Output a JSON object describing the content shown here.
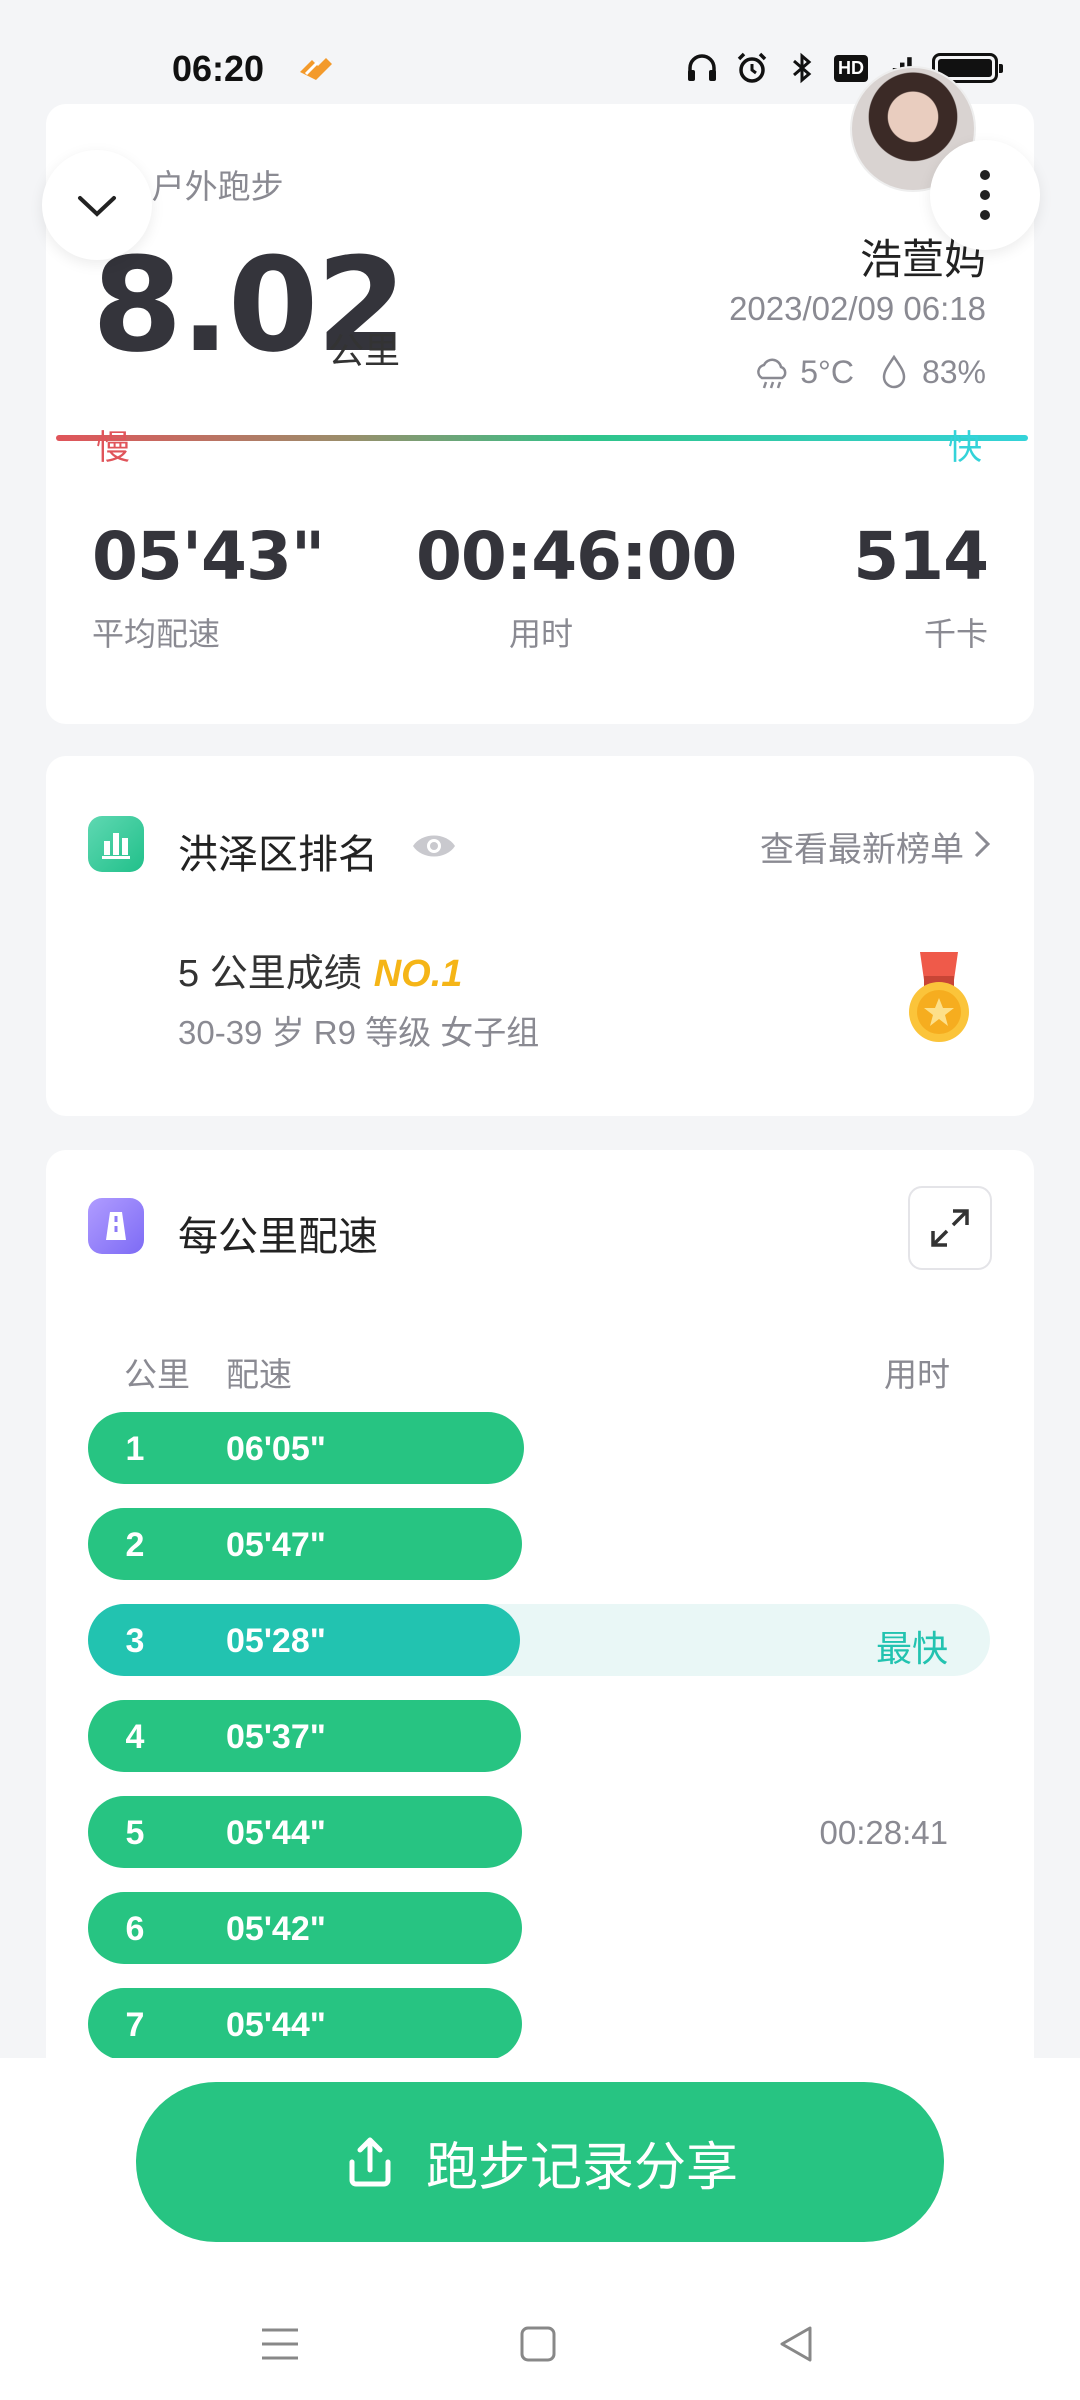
{
  "status_bar": {
    "time": "06:20",
    "hd": "HD",
    "network": "4G"
  },
  "summary": {
    "activity_type": "p · 户外跑步",
    "distance": "8.02",
    "distance_unit": "公里",
    "user_name": "浩萱妈",
    "datetime": "2023/02/09 06:18",
    "temperature": "5°C",
    "humidity": "83%",
    "pace_slow_label": "慢",
    "pace_fast_label": "快",
    "stats": [
      {
        "value": "05'43\"",
        "label": "平均配速"
      },
      {
        "value": "00:46:00",
        "label": "用时"
      },
      {
        "value": "514",
        "label": "千卡"
      }
    ]
  },
  "ranking": {
    "title": "洪泽区排名",
    "link_label": "查看最新榜单",
    "result_label": "5 公里成绩",
    "result_rank": "NO.1",
    "group_label": "30-39 岁 R9 等级 女子组"
  },
  "splits": {
    "title": "每公里配速",
    "col_km": "公里",
    "col_pace": "配速",
    "col_time": "用时",
    "fastest_label": "最快",
    "rows": [
      {
        "km": "1",
        "pace": "06'05\"",
        "elapsed": ""
      },
      {
        "km": "2",
        "pace": "05'47\"",
        "elapsed": ""
      },
      {
        "km": "3",
        "pace": "05'28\"",
        "elapsed": "",
        "fastest": true
      },
      {
        "km": "4",
        "pace": "05'37\"",
        "elapsed": ""
      },
      {
        "km": "5",
        "pace": "05'44\"",
        "elapsed": "00:28:41"
      },
      {
        "km": "6",
        "pace": "05'42\"",
        "elapsed": ""
      },
      {
        "km": "7",
        "pace": "05'44\"",
        "elapsed": ""
      }
    ]
  },
  "share_button": {
    "label": "跑步记录分享"
  },
  "colors": {
    "accent": "#27c482",
    "fastest": "#22c3b0",
    "rank_gold": "#f5b517",
    "slow": "#e0545a",
    "fast": "#34d3d9"
  }
}
